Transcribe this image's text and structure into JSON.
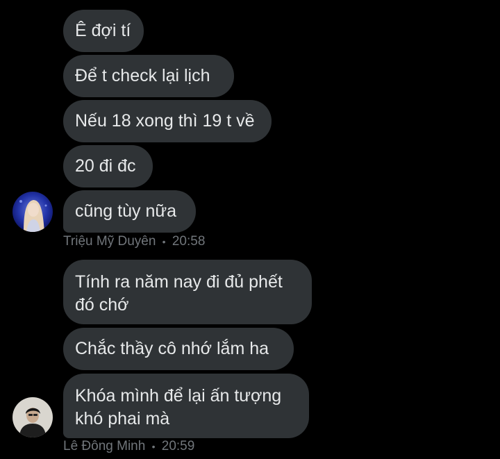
{
  "conversation": {
    "group1": {
      "messages": [
        "Ê đợi tí",
        "Để t check lại lịch",
        "Nếu 18 xong thì 19 t về",
        "20 đi đc",
        "cũng tùy nữa"
      ],
      "sender": "Triệu Mỹ Duyên",
      "separator": "•",
      "time": "20:58",
      "avatar_icon": "user-avatar-photo"
    },
    "group2": {
      "messages": [
        "Tính ra năm nay đi đủ phết đó chớ",
        "Chắc thầy cô nhớ lắm ha",
        "Khóa mình để lại ấn tượng khó phai mà"
      ],
      "sender": "Lê Đông Minh",
      "separator": "•",
      "time": "20:59",
      "avatar_icon": "user-avatar-photo"
    }
  },
  "colors": {
    "background": "#000000",
    "bubble": "#2f3336",
    "text": "#e7e9ea",
    "meta": "#71767b"
  }
}
